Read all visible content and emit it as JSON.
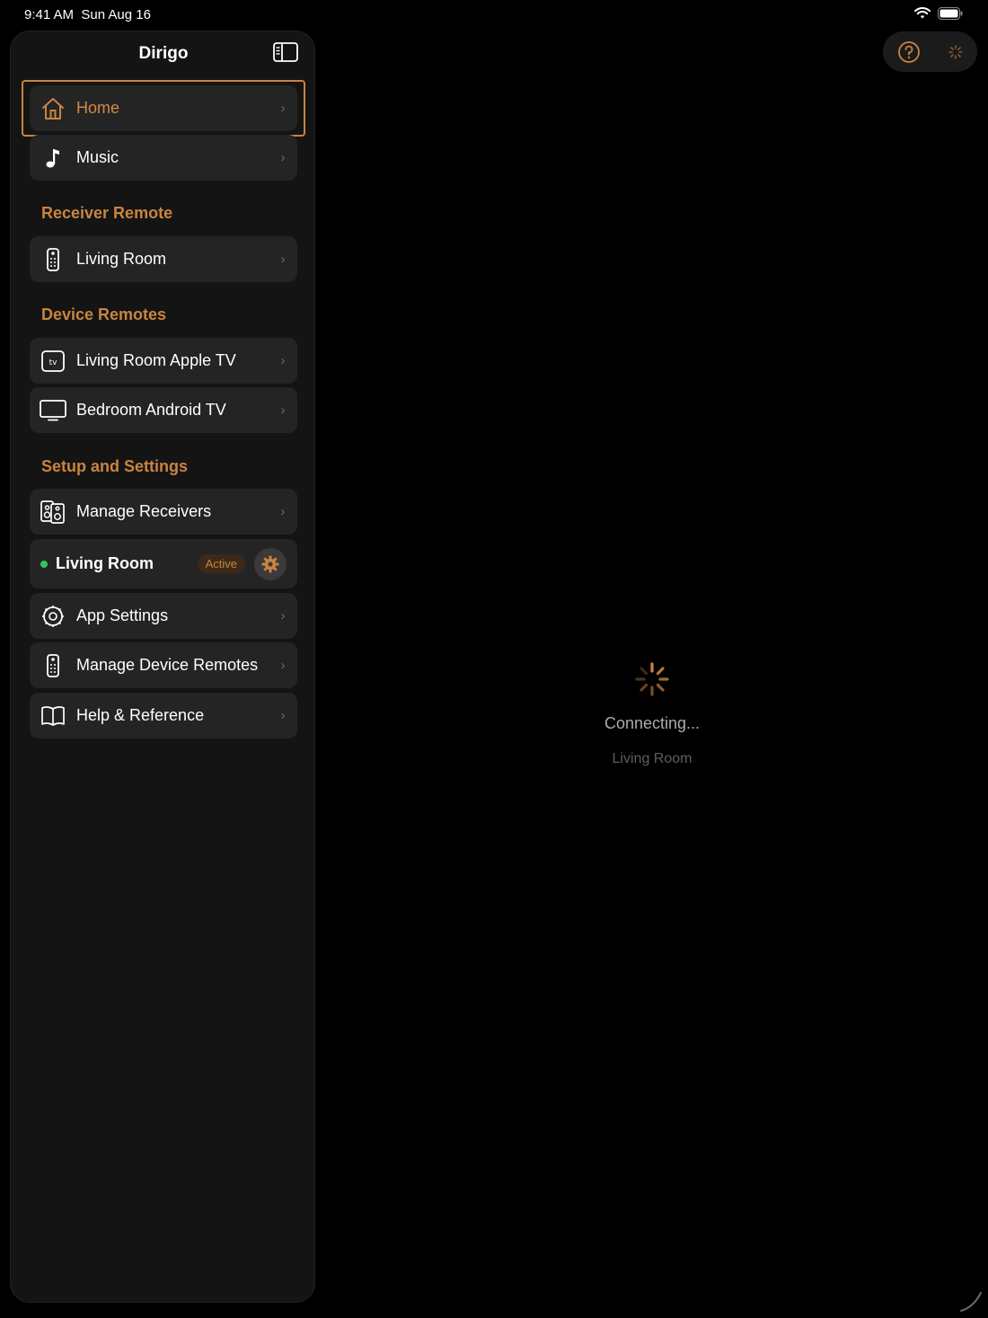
{
  "status_bar": {
    "time": "9:41 AM",
    "date": "Sun Aug 16"
  },
  "sidebar": {
    "title": "Dirigo",
    "top_items": [
      {
        "label": "Home",
        "icon": "house-icon",
        "selected": true
      },
      {
        "label": "Music",
        "icon": "music-note-icon"
      }
    ],
    "receiver_remote": {
      "header": "Receiver Remote",
      "items": [
        {
          "label": "Living Room",
          "icon": "remote-icon"
        }
      ]
    },
    "device_remotes": {
      "header": "Device Remotes",
      "items": [
        {
          "label": "Living Room Apple TV",
          "icon": "apple-tv-icon"
        },
        {
          "label": "Bedroom Android TV",
          "icon": "tv-icon"
        }
      ]
    },
    "setup": {
      "header": "Setup and Settings",
      "manage_receivers": "Manage Receivers",
      "active_receiver": {
        "label": "Living Room",
        "badge": "Active"
      },
      "app_settings": "App Settings",
      "manage_device_remotes": "Manage Device Remotes",
      "help": "Help & Reference"
    }
  },
  "main": {
    "status": "Connecting...",
    "subtitle": "Living Room"
  },
  "colors": {
    "accent": "#c9843f",
    "active_dot": "#34c759",
    "background": "#000000",
    "row": "#242424"
  }
}
